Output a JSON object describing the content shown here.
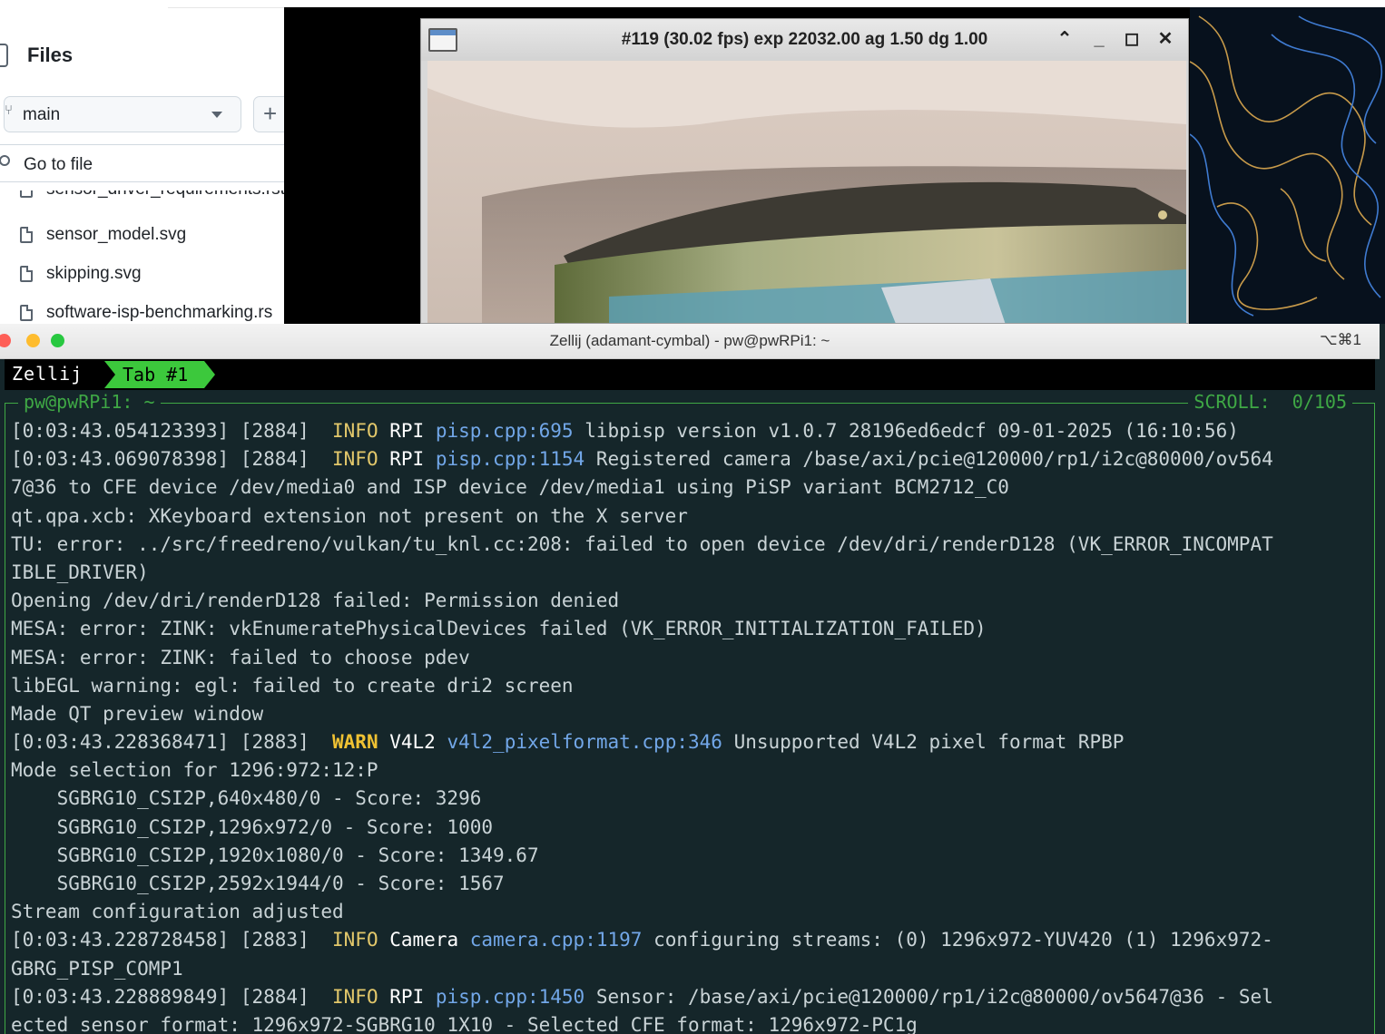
{
  "files_panel": {
    "title": "Files",
    "branch": "main",
    "add_label": "+",
    "go_to_file": "Go to file",
    "items": [
      "sensor_model.svg",
      "skipping.svg",
      "software-isp-benchmarking.rs"
    ],
    "cut_item": "sensor_driver_requirements.rst"
  },
  "preview_window": {
    "title": "#119 (30.02 fps) exp 22032.00 ag 1.50 dg 1.00"
  },
  "terminal": {
    "window_title": "Zellij (adamant-cymbal) - pw@pwRPi1: ~",
    "shortcut": "⌥⌘1",
    "zellij_name": "Zellij",
    "tab_label": "Tab #1",
    "pane_title": "pw@pwRPi1: ~",
    "scroll_label": "SCROLL:  0/105",
    "lines": [
      {
        "ts": "[0:03:43.054123393] [2884]  ",
        "level": "INFO",
        "cat": "RPI",
        "src": "pisp.cpp:695",
        "msg": " libpisp version v1.0.7 28196ed6edcf 09-01-2025 (16:10:56)"
      },
      {
        "ts": "[0:03:43.069078398] [2884]  ",
        "level": "INFO",
        "cat": "RPI",
        "src": "pisp.cpp:1154",
        "msg": " Registered camera /base/axi/pcie@120000/rp1/i2c@80000/ov564"
      },
      {
        "text": "7@36 to CFE device /dev/media0 and ISP device /dev/media1 using PiSP variant BCM2712_C0"
      },
      {
        "text": "qt.qpa.xcb: XKeyboard extension not present on the X server"
      },
      {
        "text": "TU: error: ../src/freedreno/vulkan/tu_knl.cc:208: failed to open device /dev/dri/renderD128 (VK_ERROR_INCOMPAT"
      },
      {
        "text": "IBLE_DRIVER)"
      },
      {
        "text": "Opening /dev/dri/renderD128 failed: Permission denied"
      },
      {
        "text": "MESA: error: ZINK: vkEnumeratePhysicalDevices failed (VK_ERROR_INITIALIZATION_FAILED)"
      },
      {
        "text": "MESA: error: ZINK: failed to choose pdev"
      },
      {
        "text": "libEGL warning: egl: failed to create dri2 screen"
      },
      {
        "text": "Made QT preview window"
      },
      {
        "ts": "[0:03:43.228368471] [2883]  ",
        "level": "WARN",
        "cat": "V4L2",
        "src": "v4l2_pixelformat.cpp:346",
        "msg": " Unsupported V4L2 pixel format RPBP"
      },
      {
        "text": "Mode selection for 1296:972:12:P"
      },
      {
        "text": "    SGBRG10_CSI2P,640x480/0 - Score: 3296"
      },
      {
        "text": "    SGBRG10_CSI2P,1296x972/0 - Score: 1000"
      },
      {
        "text": "    SGBRG10_CSI2P,1920x1080/0 - Score: 1349.67"
      },
      {
        "text": "    SGBRG10_CSI2P,2592x1944/0 - Score: 1567"
      },
      {
        "text": "Stream configuration adjusted"
      },
      {
        "ts": "[0:03:43.228728458] [2883]  ",
        "level": "INFO",
        "cat": "Camera",
        "src": "camera.cpp:1197",
        "msg": " configuring streams: (0) 1296x972-YUV420 (1) 1296x972-"
      },
      {
        "text": "GBRG_PISP_COMP1"
      },
      {
        "ts": "[0:03:43.228889849] [2884]  ",
        "level": "INFO",
        "cat": "RPI",
        "src": "pisp.cpp:1450",
        "msg": " Sensor: /base/axi/pcie@120000/rp1/i2c@80000/ov5647@36 - Sel"
      },
      {
        "text": "ected sensor format: 1296x972-SGBRG10_1X10 - Selected CFE format: 1296x972-PC1g"
      }
    ]
  },
  "colors": {
    "terminal_bg": "#15262a",
    "zellij_green": "#3fa845",
    "info": "#e3c86b",
    "warn": "#f0c233",
    "source": "#72a7e8"
  }
}
